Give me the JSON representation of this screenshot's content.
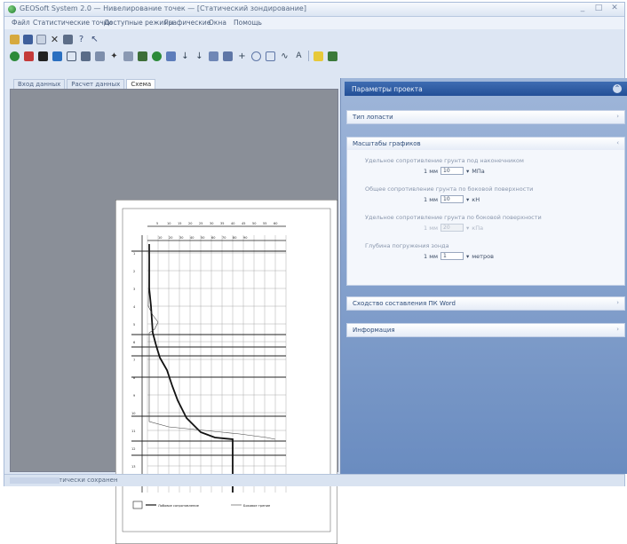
{
  "window": {
    "title": "GEOSoft System 2.0 — Нивелирование точек — [Статический зондирование]",
    "controls": [
      "_",
      "□",
      "✕"
    ]
  },
  "menu": [
    "Файл",
    "Статистические точки",
    "Доступные режимы",
    "Графические",
    "Окна",
    "Помощь"
  ],
  "toolbar1": [
    "open-icon",
    "save-icon",
    "copy-icon",
    "delete-icon",
    "print-icon",
    "help-icon",
    "pointer-icon"
  ],
  "toolbar2": [
    "green-circle-icon",
    "red-icon",
    "stop-icon",
    "download-icon",
    "grid-icon",
    "table-icon",
    "chart-icon",
    "star-icon",
    "chart2-icon",
    "tree-icon",
    "flower-icon",
    "arrow-up-icon",
    "arrow-down-icon",
    "export-icon",
    "import-icon",
    "zoom-icon",
    "select-icon",
    "edit-icon",
    "line-icon",
    "curve-icon",
    "text-icon",
    "yellow-icon",
    "settings-icon"
  ],
  "tabs": [
    "Вход данных",
    "Расчет данных",
    "Схема"
  ],
  "panel": {
    "title": "Параметры проекта",
    "sections": {
      "tip_rezki": "Тип лопасти",
      "masshtaby": "Масштабы графиков",
      "svyaz": "Сходство составления ПК Word",
      "info": "Информация"
    },
    "fields": [
      {
        "caption": "Удельное сопротивление грунта под наконечником",
        "prefix": "1 мм",
        "value": "10",
        "unit": "МПа",
        "disabled": false
      },
      {
        "caption": "Общее сопротивление грунта по боковой поверхности",
        "prefix": "1 мм",
        "value": "10",
        "unit": "кН",
        "disabled": false
      },
      {
        "caption": "Удельное сопротивление грунта по боковой поверхности",
        "prefix": "1 мм",
        "value": "20",
        "unit": "кПа",
        "disabled": true
      },
      {
        "caption": "Глубина погружения зонда",
        "prefix": "1 мм",
        "value": "1",
        "unit": "метров",
        "disabled": false
      }
    ]
  },
  "chart_legend": [
    "Лобовое сопротивление",
    "Боковое трение"
  ],
  "status": {
    "text": "Проект автоматически сохранен"
  },
  "colors": {
    "panel_header": "#2c579c",
    "panel_bg": "#7f9ccb",
    "page_bg": "#8a8f98"
  }
}
